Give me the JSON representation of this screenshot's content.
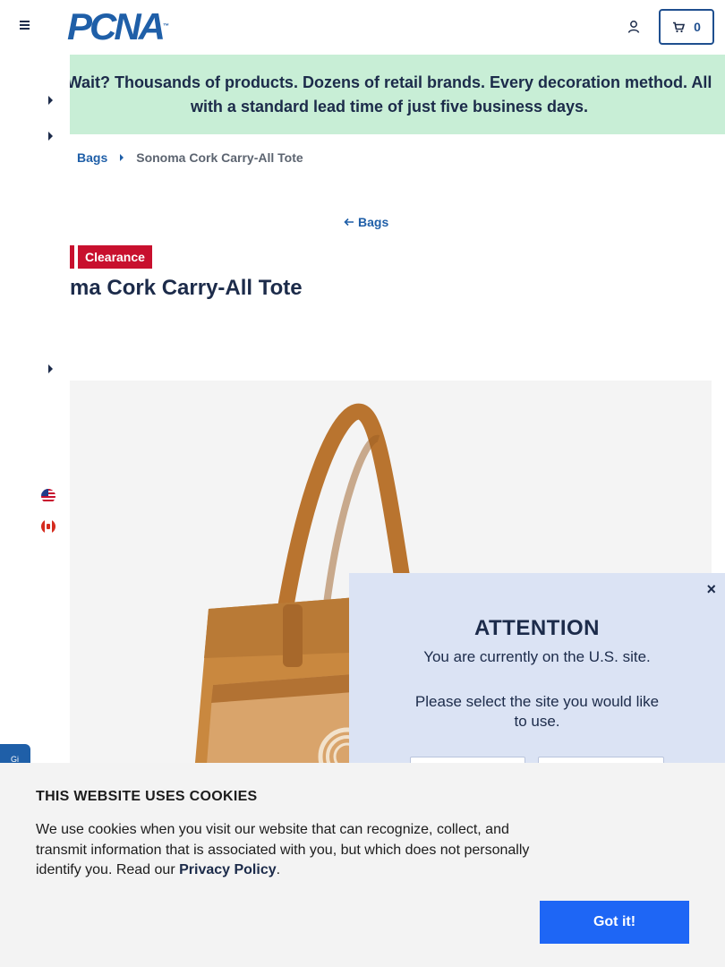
{
  "header": {
    "logo_text": "PCNA",
    "logo_tm": "™",
    "cart_count": "0"
  },
  "promo": {
    "text": "Wait? Thousands of products. Dozens of retail brands. Every decoration method. All with a standard lead time of just five business days."
  },
  "breadcrumb": {
    "items": [
      "Bags",
      "Sonoma Cork Carry-All Tote"
    ]
  },
  "product": {
    "back_label": "Bags",
    "badge": "Clearance",
    "title": "Sonoma Cork Carry-All Tote",
    "title_visible": "ma Cork Carry-All Tote"
  },
  "modal": {
    "title": "ATTENTION",
    "line1": "You are currently on the U.S. site.",
    "line2": "Please select the site you would like to use.",
    "close": "×"
  },
  "feedback": {
    "label": "Gi"
  },
  "cookie": {
    "title": "THIS WEBSITE USES COOKIES",
    "text_before": "We use cookies when you visit our website that can recognize, collect, and transmit information that is associated with you, but which does not personally identify you. Read our ",
    "link": "Privacy Policy",
    "text_after": ".",
    "button": "Got it!"
  },
  "colors": {
    "brand": "#1f5fa8",
    "promo_bg": "#c8eed6",
    "clearance": "#c8102e",
    "modal_bg": "#dbe3f4",
    "cookie_button": "#1e66f5"
  }
}
